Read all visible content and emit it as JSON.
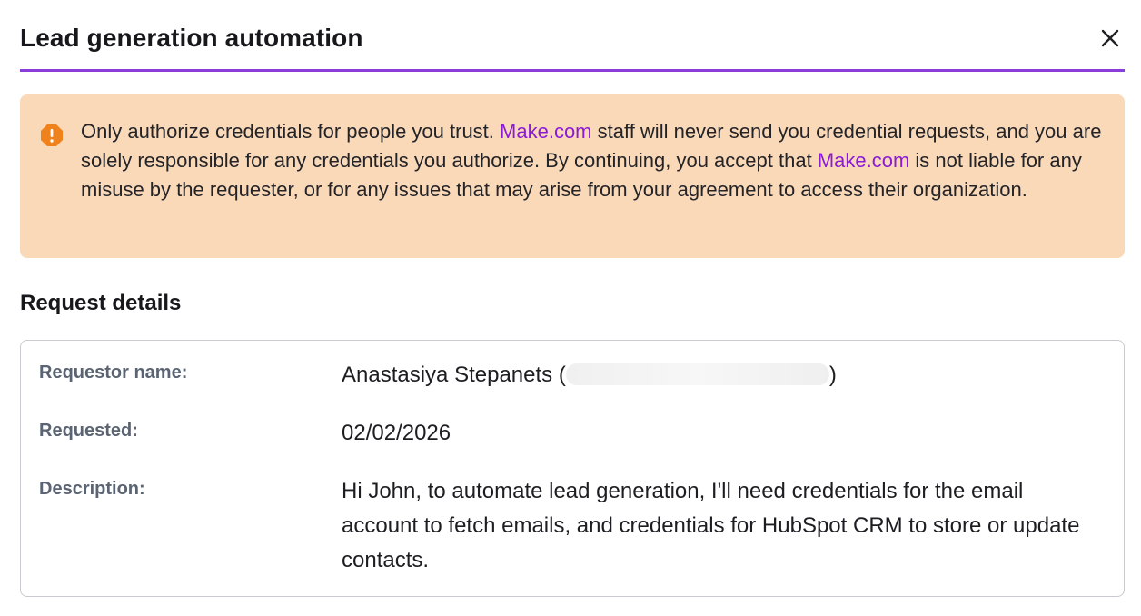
{
  "dialog": {
    "title": "Lead generation automation",
    "close_icon": "close-icon"
  },
  "warning": {
    "icon": "warning-icon",
    "colors": {
      "background": "#fad9b9",
      "icon": "#f0821e",
      "link": "#8b1bd8"
    },
    "text_1": "Only authorize credentials for people you trust. ",
    "link_1": "Make.com",
    "text_2": " staff will never send you credential requests, and you are solely responsible for any credentials you authorize. By continuing, you accept that ",
    "link_2": "Make.com",
    "text_3": " is not liable for any misuse by the requester, or for any issues that may arise from your agreement to access their organization."
  },
  "request": {
    "section_title": "Request details",
    "requestor_label": "Requestor name:",
    "requestor_name": "Anastasiya Stepanets (",
    "requestor_close": ")",
    "requested_label": "Requested:",
    "requested_date": "02/02/2026",
    "description_label": "Description:",
    "description": "Hi John, to automate lead generation, I'll need credentials for the email account to fetch emails, and credentials for HubSpot CRM to store or update contacts."
  },
  "accent_color": "#8b3ddc"
}
